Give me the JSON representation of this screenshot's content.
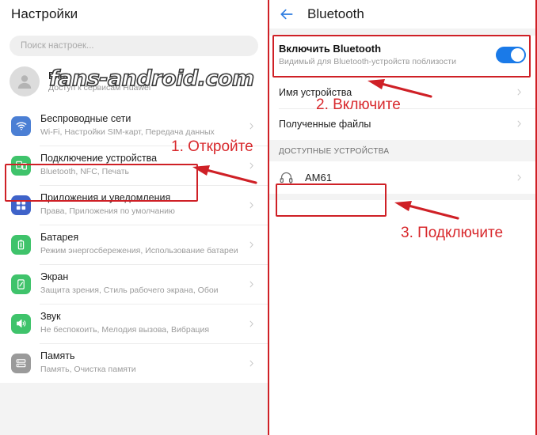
{
  "left_panel": {
    "header": {
      "title": "Настройки"
    },
    "search": {
      "placeholder": "Поиск настроек..."
    },
    "account": {
      "title": "Вход",
      "subtitle": "Доступ к сервисам Huawei",
      "avatar_icon": "person-icon"
    },
    "watermark": "fans-android.com",
    "items": [
      {
        "title": "Беспроводные сети",
        "subtitle": "Wi-Fi, Настройки SIM-карт, Передача данных",
        "icon": "wifi-icon",
        "icon_color": "#4b7fd4"
      },
      {
        "title": "Подключение устройства",
        "subtitle": "Bluetooth, NFC, Печать",
        "icon": "device-connection-icon",
        "icon_color": "#3fc36b"
      },
      {
        "title": "Приложения и уведомления",
        "subtitle": "Права, Приложения по умолчанию",
        "icon": "apps-grid-icon",
        "icon_color": "#3f63c9"
      },
      {
        "title": "Батарея",
        "subtitle": "Режим энергосбережения, Использование батареи",
        "icon": "battery-icon",
        "icon_color": "#3fc36b"
      },
      {
        "title": "Экран",
        "subtitle": "Защита зрения, Стиль рабочего экрана, Обои",
        "icon": "screen-icon",
        "icon_color": "#3fc36b"
      },
      {
        "title": "Звук",
        "subtitle": "Не беспокоить, Мелодия вызова, Вибрация",
        "icon": "sound-icon",
        "icon_color": "#3fc36b"
      },
      {
        "title": "Память",
        "subtitle": "Память, Очистка памяти",
        "icon": "storage-icon",
        "icon_color": "#9a9a9a"
      }
    ]
  },
  "right_panel": {
    "header": {
      "title": "Bluetooth",
      "back_icon": "back-arrow-icon"
    },
    "toggle": {
      "title": "Включить Bluetooth",
      "subtitle": "Видимый для Bluetooth-устройств поблизости",
      "state": "on"
    },
    "rows": [
      {
        "label": "Имя устройства"
      },
      {
        "label": "Полученные файлы"
      }
    ],
    "section_title": "ДОСТУПНЫЕ УСТРОЙСТВА",
    "devices": [
      {
        "name": "AM61",
        "icon": "headset-icon"
      }
    ]
  },
  "annotations": {
    "step1": "1. Откройте",
    "step2": "2. Включите",
    "step3": "3. Подключите",
    "color": "#d8282c"
  }
}
